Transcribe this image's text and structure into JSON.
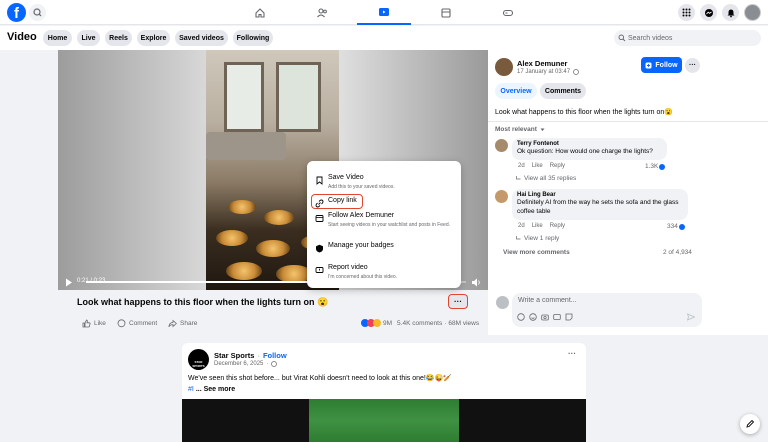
{
  "topbar": {
    "logo": "f",
    "nav_icons": [
      "home-icon",
      "friends-icon",
      "video-icon",
      "marketplace-icon",
      "gaming-icon"
    ],
    "right_icons": [
      "menu-grid-icon",
      "messenger-icon",
      "bell-icon"
    ]
  },
  "subbar": {
    "title": "Video",
    "tabs": [
      "Home",
      "Live",
      "Reels",
      "Explore",
      "Saved videos",
      "Following"
    ],
    "search_placeholder": "Search videos"
  },
  "video": {
    "time": "0:21 / 0:23",
    "progress": 0.91,
    "caption": "Look what happens to this floor when the lights turn on 😮"
  },
  "menu": {
    "items": [
      {
        "label": "Save Video",
        "sub": "Add this to your saved videos."
      },
      {
        "label": "Copy link",
        "sub": ""
      },
      {
        "label": "Follow Alex Demuner",
        "sub": "Start seeing videos in your watchlist and posts in Feed."
      },
      {
        "label": "Manage your badges",
        "sub": ""
      },
      {
        "label": "Report video",
        "sub": "I'm concerned about this video."
      }
    ]
  },
  "actions": {
    "like": "Like",
    "comment": "Comment",
    "share": "Share",
    "reactions": "9M",
    "comments_count": "5.4K comments",
    "views": "68M views",
    "more": "···"
  },
  "panel": {
    "author": "Alex Demuner",
    "date": "17 January at 03:47",
    "follow": "Follow",
    "tabs": [
      "Overview",
      "Comments"
    ],
    "description": "Look what happens to this floor when the lights turn on😮",
    "sort": "Most relevant",
    "comments": [
      {
        "name": "Terry Fontenot",
        "text": "Ok question: How would one charge the lights?",
        "age": "2d",
        "like": "Like",
        "reply": "Reply",
        "reactions": "1.3K",
        "replies": "View all 35 replies"
      },
      {
        "name": "Hai Ling Bear",
        "text": "Definitely AI from the way he sets the sofa and the glass coffee table",
        "age": "2d",
        "like": "Like",
        "reply": "Reply",
        "reactions": "334",
        "replies": "View 1 reply"
      }
    ],
    "view_more": "View more comments",
    "count": "2 of 4,934",
    "write_placeholder": "Write a comment..."
  },
  "feed": {
    "page_name": "Star Sports",
    "follow": "Follow",
    "date": "December 6, 2025",
    "text": "We've seen this shot before... but Virat Kohli doesn't need to look at this one!😂😜🏏",
    "hashtag": "#I",
    "see_more": "... See more",
    "more": "···",
    "avatar_text": "STAR SPORTS"
  }
}
